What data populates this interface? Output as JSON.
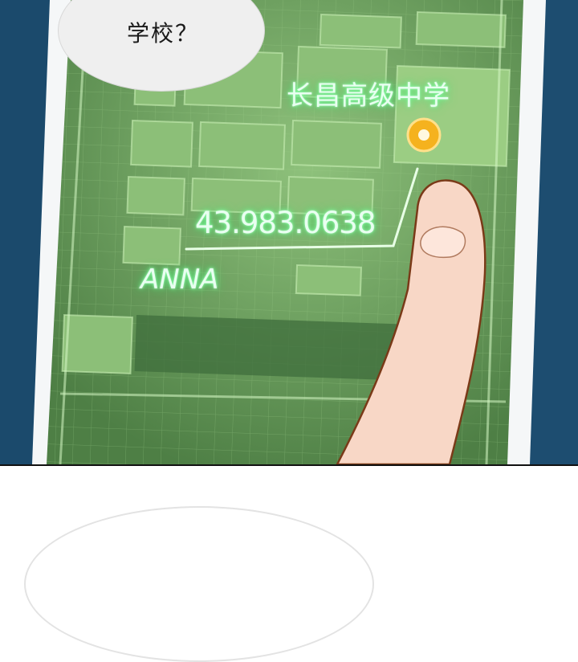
{
  "speech_bubble": {
    "text": "学校？"
  },
  "map": {
    "location_label": "长昌高级中学",
    "coordinates": "43.983.0638",
    "name_label": "ANNA",
    "pin_icon": "location-pin-icon",
    "accent_color": "#7dff9e",
    "screen_color": "#6f9e60",
    "pin_color": "#f5b21e"
  }
}
